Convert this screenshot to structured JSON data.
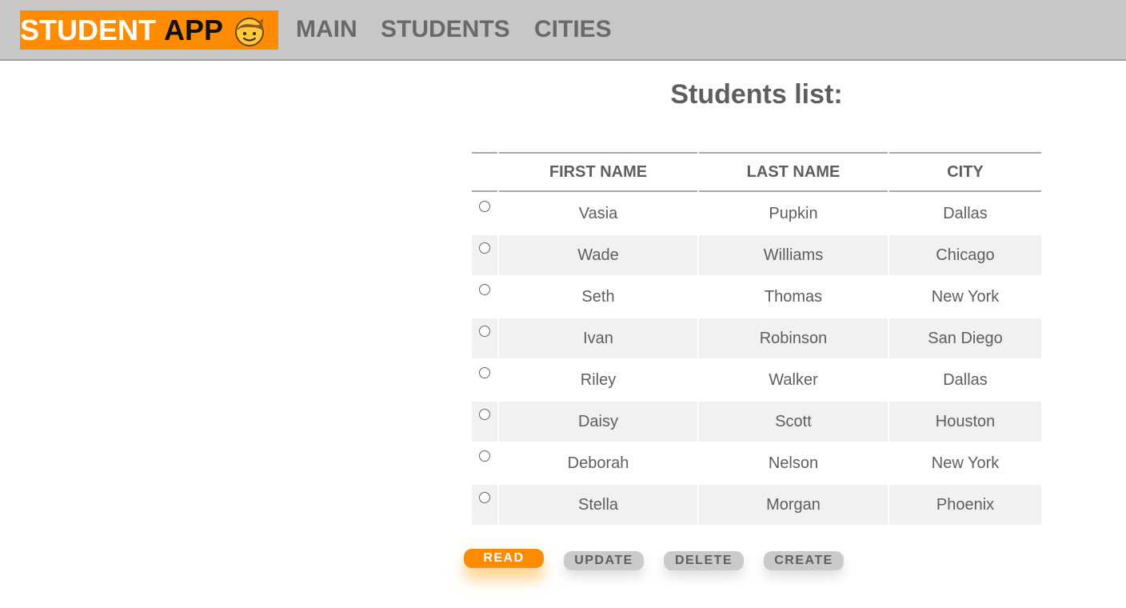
{
  "header": {
    "brand_word1": "STUDENT",
    "brand_word2": "APP",
    "brand_icon": "boy-face-icon",
    "nav": [
      "MAIN",
      "STUDENTS",
      "CITIES"
    ]
  },
  "main": {
    "title": "Students list:",
    "table": {
      "columns": [
        "FIRST NAME",
        "LAST NAME",
        "CITY"
      ],
      "rows": [
        {
          "first": "Vasia",
          "last": "Pupkin",
          "city": "Dallas"
        },
        {
          "first": "Wade",
          "last": "Williams",
          "city": "Chicago"
        },
        {
          "first": "Seth",
          "last": "Thomas",
          "city": "New York"
        },
        {
          "first": "Ivan",
          "last": "Robinson",
          "city": "San Diego"
        },
        {
          "first": "Riley",
          "last": "Walker",
          "city": "Dallas"
        },
        {
          "first": "Daisy",
          "last": "Scott",
          "city": "Houston"
        },
        {
          "first": "Deborah",
          "last": "Nelson",
          "city": "New York"
        },
        {
          "first": "Stella",
          "last": "Morgan",
          "city": "Phoenix"
        }
      ]
    },
    "buttons": {
      "read": "READ",
      "update": "UPDATE",
      "delete": "DELETE",
      "create": "CREATE"
    }
  },
  "colors": {
    "accent": "#ff8c00",
    "topbar": "#c8c7c6",
    "text": "#5f5e5d",
    "row_alt": "#f1f1f1"
  }
}
